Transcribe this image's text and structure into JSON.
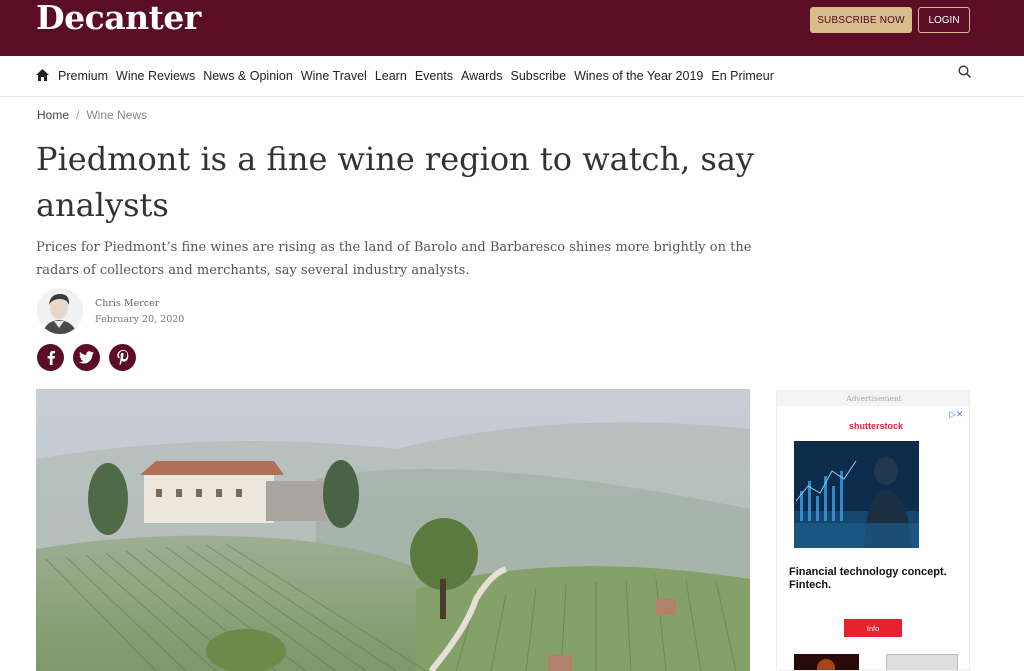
{
  "header": {
    "logo": "Decanter",
    "subscribe_label": "SUBSCRIBE NOW",
    "login_label": "LOGIN"
  },
  "nav": {
    "items": [
      "Premium",
      "Wine Reviews",
      "News & Opinion",
      "Wine Travel",
      "Learn",
      "Events",
      "Awards",
      "Subscribe",
      "Wines of the Year 2019",
      "En Primeur"
    ]
  },
  "breadcrumb": {
    "home": "Home",
    "separator": "/",
    "current": "Wine News"
  },
  "article": {
    "title": "Piedmont is a fine wine region to watch, say analysts",
    "subtitle": "Prices for Piedmont’s fine wines are rising as the land of Barolo and Barbaresco shines more brightly on the radars of collectors and merchants, say several industry analysts.",
    "author": "Chris Mercer",
    "date": "February 20, 2020"
  },
  "social": {
    "facebook": "f",
    "icons": [
      "facebook-icon",
      "twitter-icon",
      "pinterest-icon"
    ]
  },
  "ad": {
    "label": "Advertisement",
    "brand": "shutterstock",
    "headline": "Financial technology concept. Fintech.",
    "button": "Info"
  },
  "colors": {
    "brand": "#5b0d25",
    "accent": "#d9bc8c",
    "ad_red": "#e7222e"
  }
}
